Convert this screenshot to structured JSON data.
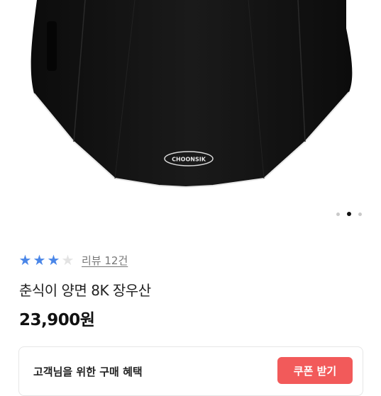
{
  "product": {
    "image_alt": "Black umbrella with CHOONSIK logo",
    "logo_text": "CHOONSIK",
    "title": "춘식이 양면 8K 장우산",
    "price": "23,900원"
  },
  "carousel": {
    "total": 3,
    "active_index": 1
  },
  "rating": {
    "stars": 3,
    "max": 4,
    "review_label": "리뷰 12건"
  },
  "benefits": {
    "title": "고객님을 위한 구매 혜택",
    "coupon_button": "쿠폰 받기"
  },
  "colors": {
    "star": "#4a86e8",
    "coupon": "#f25a5a"
  }
}
